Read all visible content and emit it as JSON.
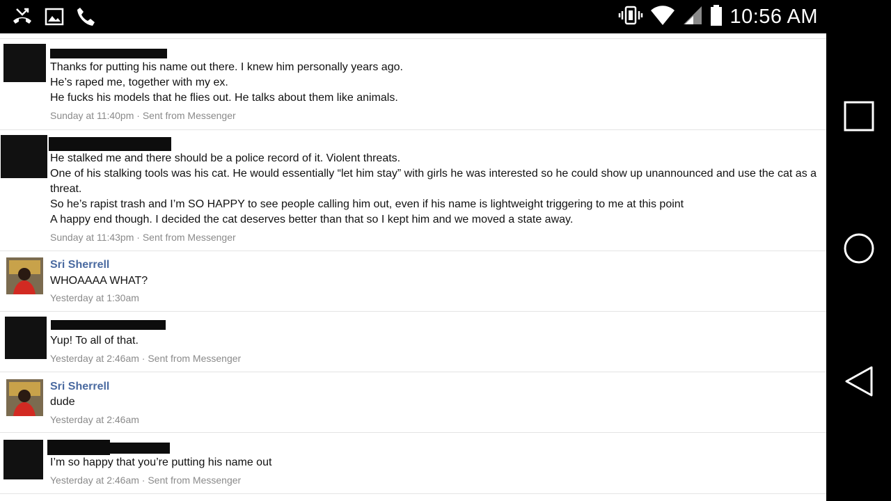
{
  "status_bar": {
    "time": "10:56 AM",
    "icons_left": [
      "missed-call-icon",
      "image-icon",
      "phone-icon"
    ],
    "icons_right": [
      "vibrate-icon",
      "wifi-icon",
      "signal-icon",
      "battery-icon"
    ]
  },
  "messages": [
    {
      "name": "",
      "redacted_name": true,
      "lines": [
        "Thanks for putting his name out there. I knew him personally years ago.",
        "He’s raped me, together with my ex.",
        "He fucks his models that he flies out. He talks about them like animals."
      ],
      "meta": "Sunday at 11:40pm · Sent from Messenger"
    },
    {
      "name": "",
      "redacted_name": true,
      "lines": [
        "He stalked me and there should be a police record of it. Violent threats.",
        "One of his stalking tools was his cat. He would essentially “let him stay” with girls he was interested so he could show up unannounced and use the cat as a threat.",
        "So he’s rapist trash and I’m SO HAPPY to see people calling him out, even if his name is lightweight triggering to me at this point",
        "A happy end though. I decided the cat deserves better than that so I kept him and we moved a state away."
      ],
      "meta": "Sunday at 11:43pm · Sent from Messenger"
    },
    {
      "name": "Sri Sherrell",
      "redacted_name": false,
      "lines": [
        "WHOAAAA WHAT?"
      ],
      "meta": "Yesterday at 1:30am"
    },
    {
      "name": "",
      "redacted_name": true,
      "lines": [
        "Yup! To all of that."
      ],
      "meta": "Yesterday at 2:46am · Sent from Messenger"
    },
    {
      "name": "Sri Sherrell",
      "redacted_name": false,
      "lines": [
        "dude"
      ],
      "meta": "Yesterday at 2:46am"
    },
    {
      "name": "",
      "redacted_name": true,
      "lines": [
        "I’m so happy that you’re putting his name out"
      ],
      "meta": "Yesterday at 2:46am · Sent from Messenger"
    }
  ],
  "nav_bar": {
    "buttons": [
      "recents-icon",
      "home-icon",
      "back-icon"
    ]
  }
}
